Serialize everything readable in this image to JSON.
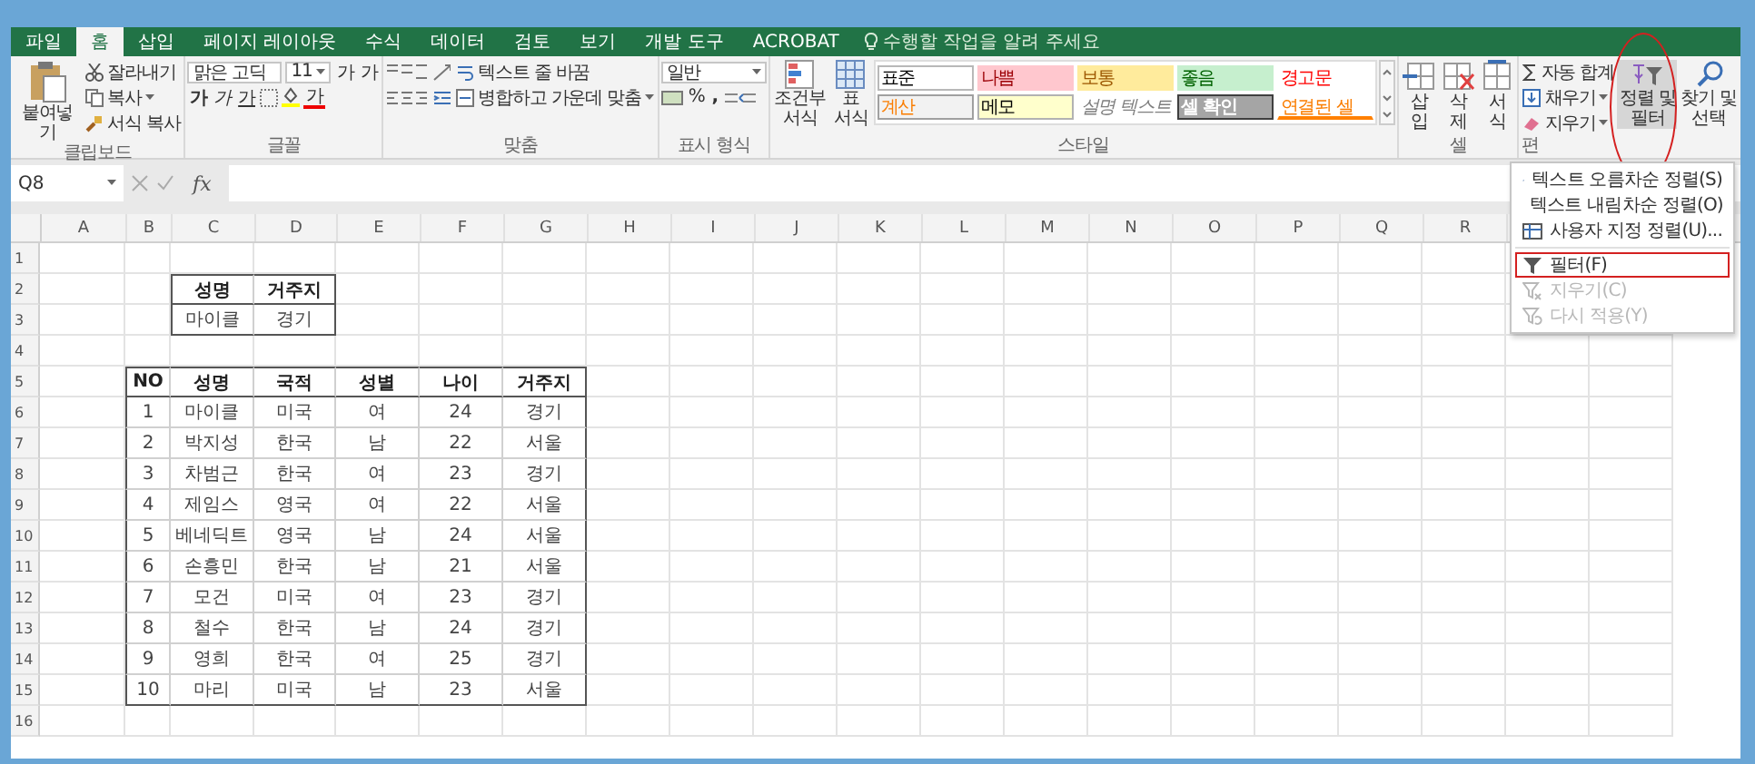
{
  "tabs": [
    {
      "label": "파일",
      "selected": false
    },
    {
      "label": "홈",
      "selected": true
    },
    {
      "label": "삽입",
      "selected": false
    },
    {
      "label": "페이지 레이아웃",
      "selected": false
    },
    {
      "label": "수식",
      "selected": false
    },
    {
      "label": "데이터",
      "selected": false
    },
    {
      "label": "검토",
      "selected": false
    },
    {
      "label": "보기",
      "selected": false
    },
    {
      "label": "개발 도구",
      "selected": false
    },
    {
      "label": "ACROBAT",
      "selected": false
    }
  ],
  "tell_me": "수행할 작업을 알려 주세요",
  "clipboard": {
    "paste": "붙여넣기",
    "cut": "잘라내기",
    "copy": "복사",
    "format_painter": "서식 복사",
    "label": "클립보드"
  },
  "font": {
    "name": "맑은 고딕",
    "size": "11",
    "grow": "가",
    "shrink": "가",
    "bold": "가",
    "italic": "가",
    "underline": "가",
    "font_color": "가",
    "label": "글꼴"
  },
  "alignment": {
    "wrap": "텍스트 줄 바꿈",
    "merge": "병합하고 가운데 맞춤",
    "label": "맞춤"
  },
  "number": {
    "format": "일반",
    "percent": "%",
    "comma": ",",
    "label": "표시 형식"
  },
  "styles": {
    "conditional": "조건부 서식",
    "as_table": "표 서식",
    "label": "스타일",
    "items": [
      {
        "label": "표준",
        "kind": "normal"
      },
      {
        "label": "나쁨",
        "kind": "bad"
      },
      {
        "label": "보통",
        "kind": "neutral"
      },
      {
        "label": "좋음",
        "kind": "good"
      },
      {
        "label": "경고문",
        "kind": "warning"
      },
      {
        "label": "계산",
        "kind": "calculation"
      },
      {
        "label": "메모",
        "kind": "note"
      },
      {
        "label": "설명 텍스트",
        "kind": "explanatory"
      },
      {
        "label": "셀 확인",
        "kind": "check"
      },
      {
        "label": "연결된 셀",
        "kind": "linked"
      }
    ]
  },
  "cells": {
    "insert": "삽입",
    "delete": "삭제",
    "format": "서식",
    "label": "셀"
  },
  "editing": {
    "autosum": "자동 합계",
    "fill": "채우기",
    "clear": "지우기",
    "sort_filter": "정렬 및 필터",
    "find_select": "찾기 및 선택",
    "label": "편",
    "circled": true
  },
  "sort_menu": {
    "items": [
      {
        "kind": "sort_ascending",
        "label": "텍스트 오름차순 정렬(S)",
        "disabled": false,
        "boxed": false
      },
      {
        "kind": "sort_descending",
        "label": "텍스트 내림차순 정렬(O)",
        "disabled": false,
        "boxed": false
      },
      {
        "kind": "custom_sort",
        "label": "사용자 지정 정렬(U)...",
        "disabled": false,
        "boxed": false
      },
      {
        "kind": "separator"
      },
      {
        "kind": "filter",
        "label": "필터(F)",
        "disabled": false,
        "boxed": true
      },
      {
        "kind": "clear",
        "label": "지우기(C)",
        "disabled": true,
        "boxed": false
      },
      {
        "kind": "reapply",
        "label": "다시 적용(Y)",
        "disabled": true,
        "boxed": false
      }
    ]
  },
  "formula_bar": {
    "name_box": "Q8",
    "fx": "fx"
  },
  "grid": {
    "columns": [
      "A",
      "B",
      "C",
      "D",
      "E",
      "F",
      "G",
      "H",
      "I",
      "J",
      "K",
      "L",
      "M",
      "N",
      "O",
      "P",
      "Q",
      "R"
    ],
    "rows": [
      "1",
      "2",
      "3",
      "4",
      "5",
      "6",
      "7",
      "8",
      "9",
      "10",
      "11",
      "12",
      "13",
      "14",
      "15",
      "16"
    ]
  },
  "tables": [
    {
      "header": [
        "성명",
        "거주지"
      ],
      "rows": [
        [
          "마이클",
          "경기"
        ]
      ]
    },
    {
      "header": [
        "NO",
        "성명",
        "국적",
        "성별",
        "나이",
        "거주지"
      ],
      "rows": [
        [
          "1",
          "마이클",
          "미국",
          "여",
          "24",
          "경기"
        ],
        [
          "2",
          "박지성",
          "한국",
          "남",
          "22",
          "서울"
        ],
        [
          "3",
          "차범근",
          "한국",
          "여",
          "23",
          "경기"
        ],
        [
          "4",
          "제임스",
          "영국",
          "여",
          "22",
          "서울"
        ],
        [
          "5",
          "베네딕트",
          "영국",
          "남",
          "24",
          "서울"
        ],
        [
          "6",
          "손흥민",
          "한국",
          "남",
          "21",
          "서울"
        ],
        [
          "7",
          "모건",
          "미국",
          "여",
          "23",
          "경기"
        ],
        [
          "8",
          "철수",
          "한국",
          "남",
          "24",
          "경기"
        ],
        [
          "9",
          "영희",
          "한국",
          "여",
          "25",
          "경기"
        ],
        [
          "10",
          "마리",
          "미국",
          "남",
          "23",
          "서울"
        ]
      ]
    }
  ]
}
